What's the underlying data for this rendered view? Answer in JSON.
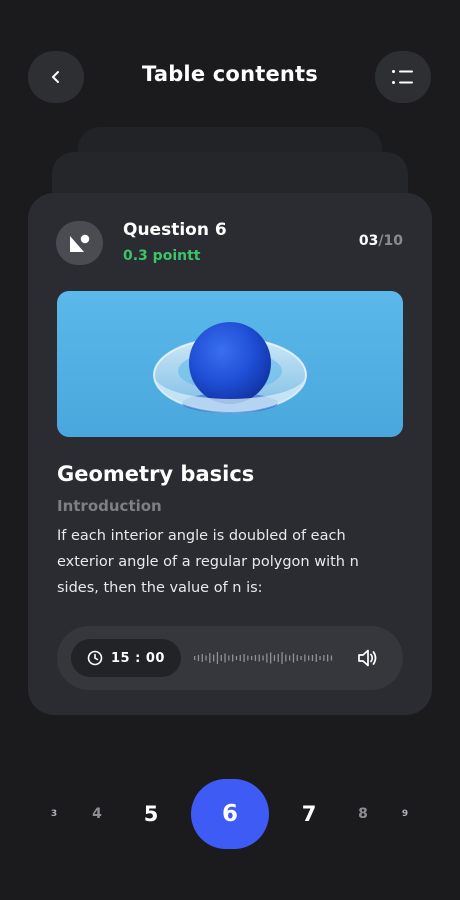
{
  "header": {
    "title": "Table contents",
    "back_icon": "chevron-left-icon",
    "menu_icon": "list-icon"
  },
  "card": {
    "avatar_icon": "shapes-icon",
    "question_title": "Question 6",
    "points": "0.3 pointt",
    "progress_current": "03",
    "progress_total": "/10",
    "lesson_title": "Geometry basics",
    "lesson_subtitle": "Introduction",
    "lesson_body": "If each interior angle is doubled of each exterior angle of a regular polygon with n sides, then the value of n is:",
    "audio": {
      "timer": "15 : 00",
      "clock_icon": "clock-icon",
      "waveform_icon": "waveform-icon",
      "speaker_icon": "speaker-icon"
    }
  },
  "pager": {
    "pages": [
      "3",
      "4",
      "5",
      "6",
      "7",
      "8",
      "9"
    ],
    "active": "6"
  },
  "colors": {
    "background": "#1b1b1d",
    "card": "#2a2c31",
    "accent": "#3e5bf5",
    "points": "#3bc46a"
  }
}
